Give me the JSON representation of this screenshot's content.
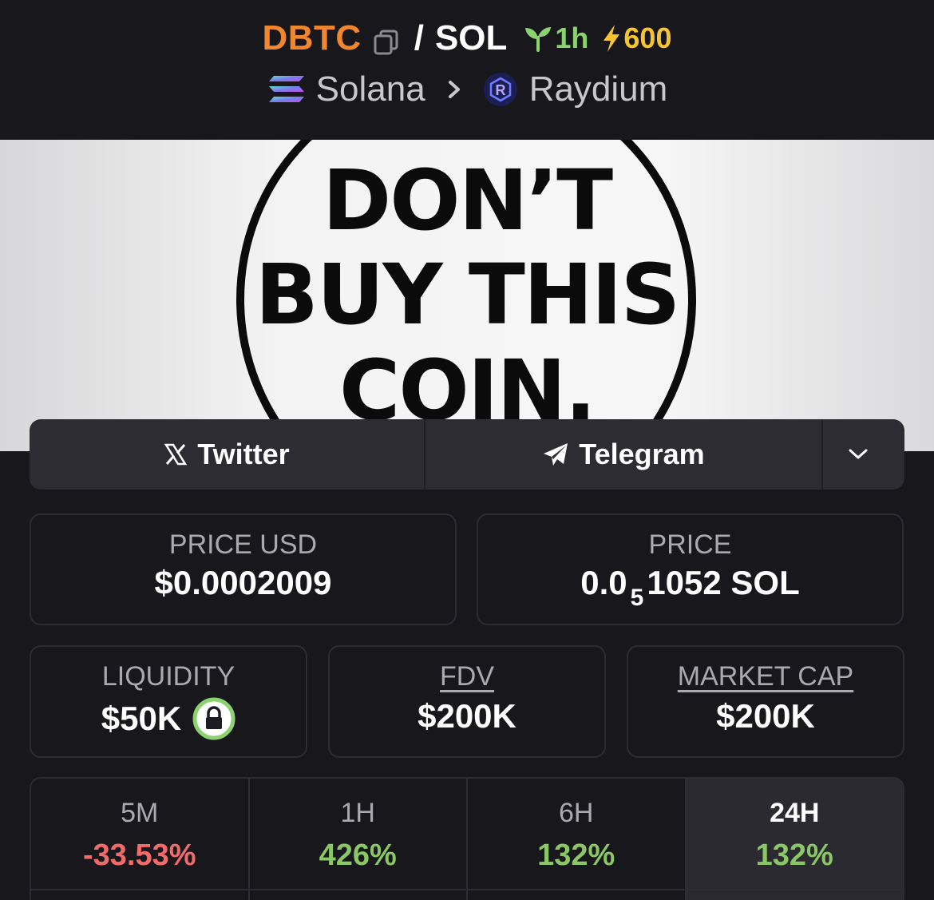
{
  "pair": {
    "base_symbol": "DBTC",
    "separator": "/",
    "quote_symbol": "SOL",
    "age": "1h",
    "boost": "600"
  },
  "chain": {
    "network": "Solana",
    "dex": "Raydium"
  },
  "banner": {
    "line1": "DON’T",
    "line2": "BUY THIS",
    "line3": "COIN."
  },
  "social": {
    "twitter": "Twitter",
    "telegram": "Telegram"
  },
  "stats": {
    "price_usd_label": "PRICE USD",
    "price_usd_value": "$0.0002009",
    "price_label": "PRICE",
    "price_prefix": "0.0",
    "price_zero_count": "5",
    "price_digits": "1052 SOL",
    "liquidity_label": "LIQUIDITY",
    "liquidity_value": "$50K",
    "fdv_label": "FDV",
    "fdv_value": "$200K",
    "mcap_label": "MARKET CAP",
    "mcap_value": "$200K"
  },
  "changes": [
    {
      "label": "5M",
      "value": "-33.53%"
    },
    {
      "label": "1H",
      "value": "426%"
    },
    {
      "label": "6H",
      "value": "132%"
    },
    {
      "label": "24H",
      "value": "132%"
    }
  ],
  "colors": {
    "base_symbol": "#f0862e",
    "age": "#8bd36e",
    "boost": "#f6c431",
    "negative": "#f26b6b",
    "positive": "#8bc765",
    "lock": "#8bd36e"
  }
}
